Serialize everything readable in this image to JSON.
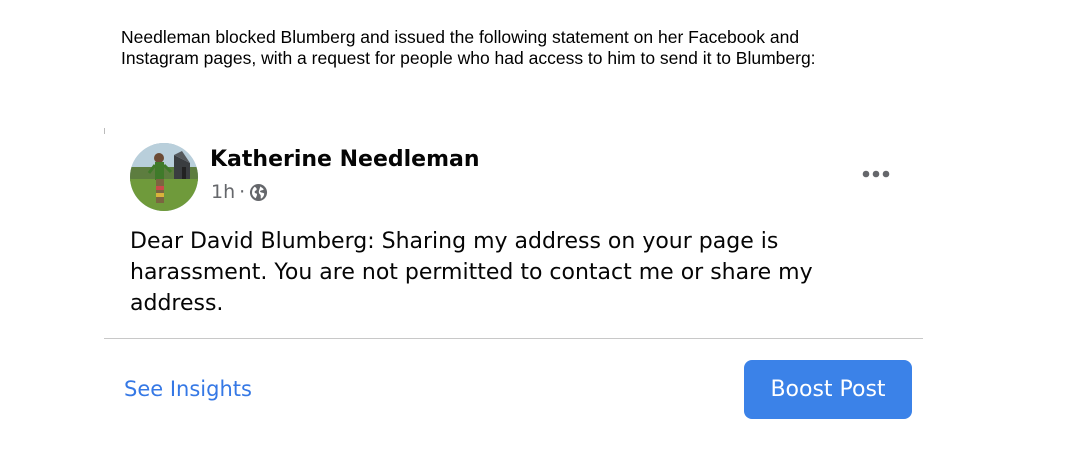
{
  "intro": {
    "line1": "Needleman blocked Blumberg and issued the following statement on her Facebook and",
    "line2": "Instagram pages, with a request for people who had access to him to send it to Blumberg:"
  },
  "post": {
    "author": "Katherine Needleman",
    "time": "1h",
    "separator": "·",
    "audience_icon": "globe-icon",
    "more_icon": "more-options-icon",
    "body_lines": [
      "Dear David Blumberg: Sharing my address on your page is",
      "harassment. You are not permitted to contact me or share my",
      "address."
    ]
  },
  "actions": {
    "insights_label": "See Insights",
    "boost_label": "Boost Post"
  },
  "colors": {
    "link_blue": "#3578e5",
    "button_blue": "#3b82e8",
    "meta_gray": "#65676b",
    "divider": "#c8c8c8"
  }
}
